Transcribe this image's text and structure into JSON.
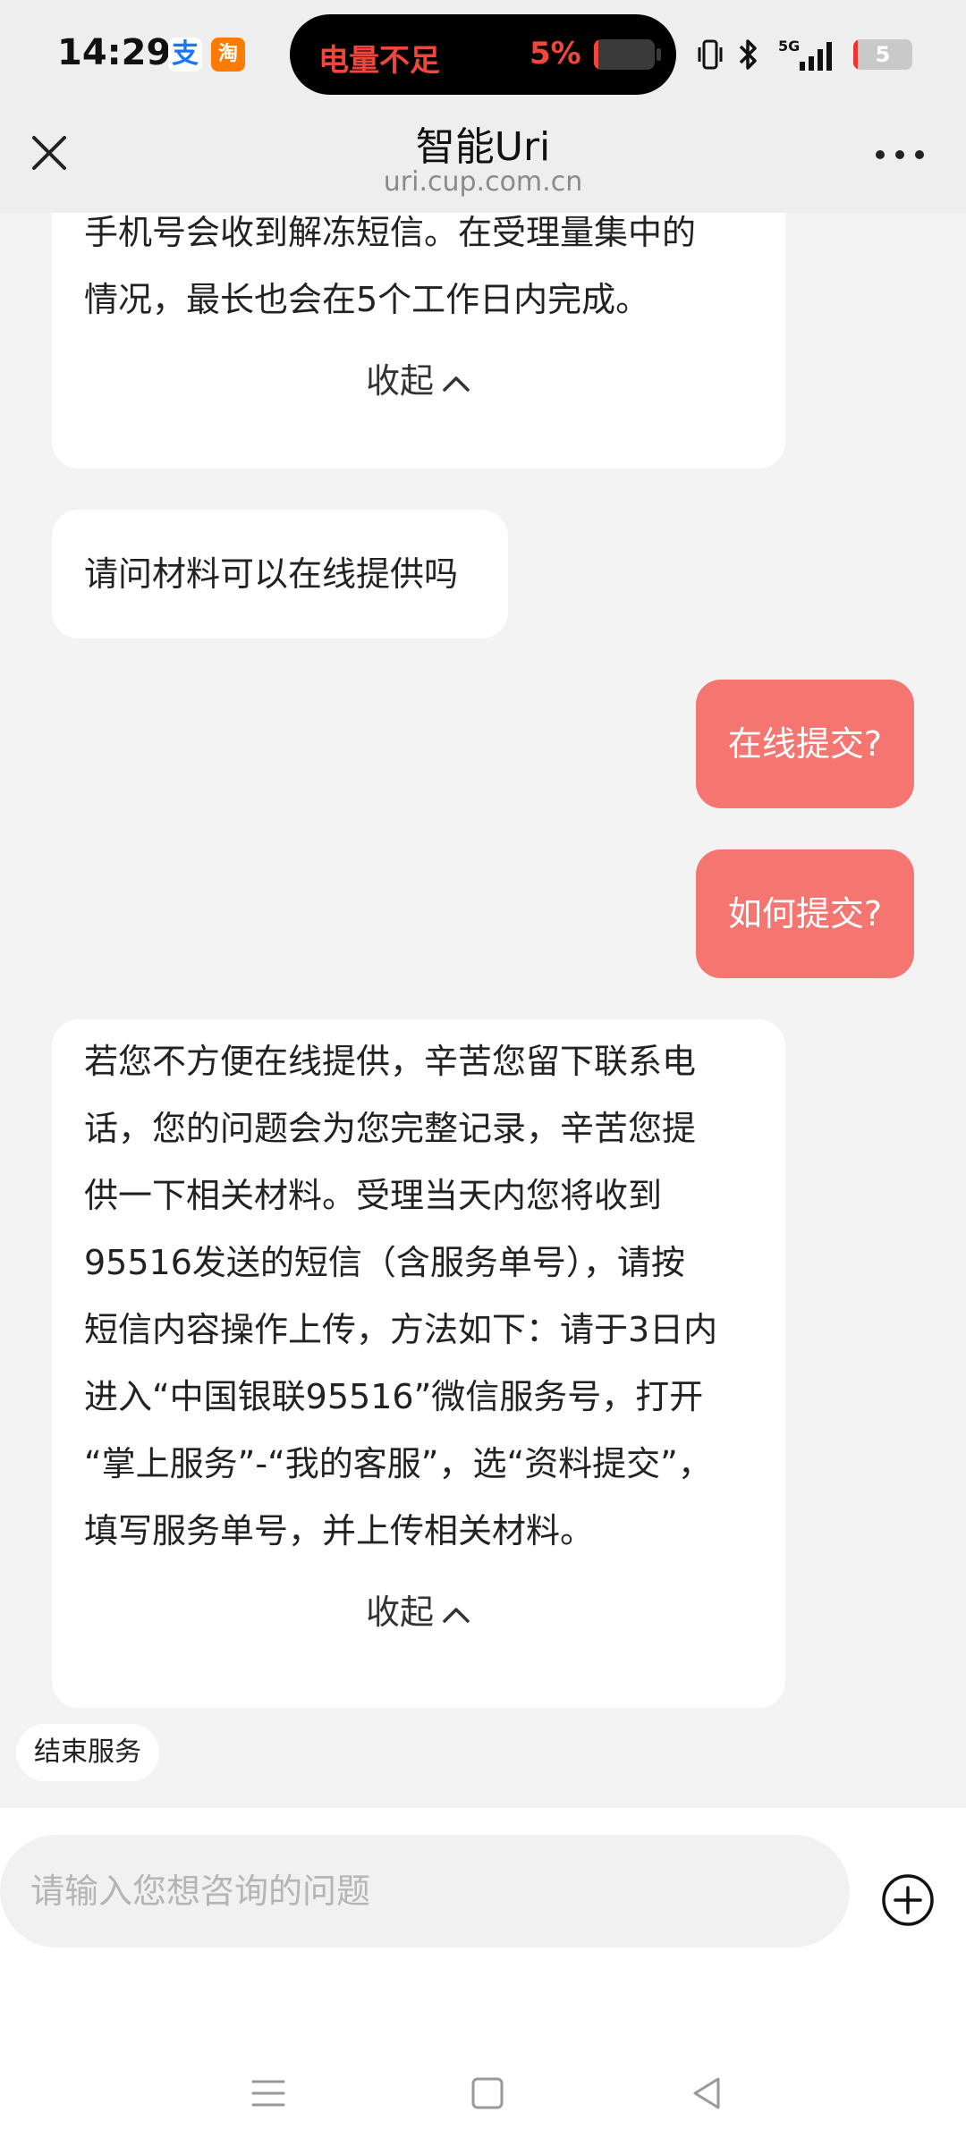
{
  "status": {
    "time": "14:29",
    "battery_warning": "电量不足",
    "battery_percent": "5%",
    "battery_level": 0.05,
    "battery_number": "5",
    "network": "5G"
  },
  "header": {
    "title": "智能Uri",
    "subtitle": "uri.cup.com.cn"
  },
  "messages": [
    {
      "side": "left",
      "lines": [
        "手机号会收到解冻短信。在受理量集中的",
        "情况，最长也会在5个工作日内完成。"
      ],
      "collapse": "收起"
    },
    {
      "side": "left",
      "lines": [
        "请问材料可以在线提供吗"
      ]
    },
    {
      "side": "right",
      "text": "在线提交?"
    },
    {
      "side": "right",
      "text": "如何提交?"
    },
    {
      "side": "left",
      "lines": [
        "若您不方便在线提供，辛苦您留下联系电",
        "话，您的问题会为您完整记录，辛苦您提",
        "供一下相关材料。受理当天内您将收到",
        "95516发送的短信（含服务单号），请按",
        "短信内容操作上传，方法如下：请于3日内",
        "进入“中国银联95516”微信服务号，打开",
        "“掌上服务”-“我的客服”，选“资料提交”，",
        "填写服务单号，并上传相关材料。"
      ],
      "collapse": "收起"
    }
  ],
  "end_service": "结束服务",
  "input": {
    "placeholder": "请输入您想咨询的问题"
  },
  "colors": {
    "user_bubble": "#f57571",
    "battery_warning": "#f0463c"
  }
}
